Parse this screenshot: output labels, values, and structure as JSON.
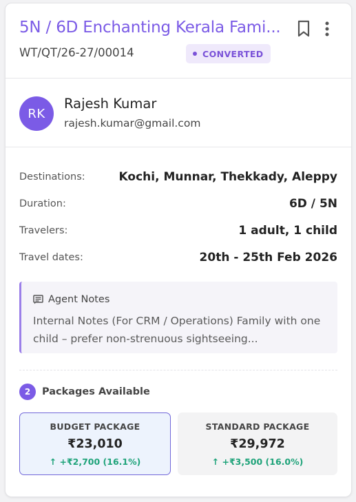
{
  "quote": {
    "title": "5N / 6D Enchanting Kerala Fami...",
    "id": "WT/QT/26-27/00014",
    "status": "CONVERTED"
  },
  "customer": {
    "initials": "RK",
    "name": "Rajesh Kumar",
    "email": "rajesh.kumar@gmail.com"
  },
  "details": [
    {
      "label": "Destinations:",
      "value": "Kochi, Munnar, Thekkady, Aleppy"
    },
    {
      "label": "Duration:",
      "value": "6D / 5N"
    },
    {
      "label": "Travelers:",
      "value": "1 adult, 1 child"
    },
    {
      "label": "Travel dates:",
      "value": "20th - 25th Feb 2026"
    }
  ],
  "notes": {
    "heading": "Agent Notes",
    "text": "Internal Notes (For CRM / Operations) Family with one child – prefer non-strenuous sightseeing..."
  },
  "packages": {
    "count": "2",
    "heading": "Packages Available",
    "items": [
      {
        "name": "BUDGET PACKAGE",
        "price": "₹23,010",
        "delta": "↑ +₹2,700 (16.1%)",
        "selected": true
      },
      {
        "name": "STANDARD PACKAGE",
        "price": "₹29,972",
        "delta": "↑ +₹3,500 (16.0%)",
        "selected": false
      }
    ]
  },
  "icons": {
    "bookmark": "bookmark-icon",
    "more": "more-vertical-icon",
    "notes": "notes-icon",
    "arrow": "arrow-up-icon"
  },
  "colors": {
    "accent": "#7b5be6",
    "badge_bg": "#efe9fb",
    "positive": "#1fa37a",
    "selected_bg": "#edf3fd",
    "selected_border": "#7167d9"
  }
}
